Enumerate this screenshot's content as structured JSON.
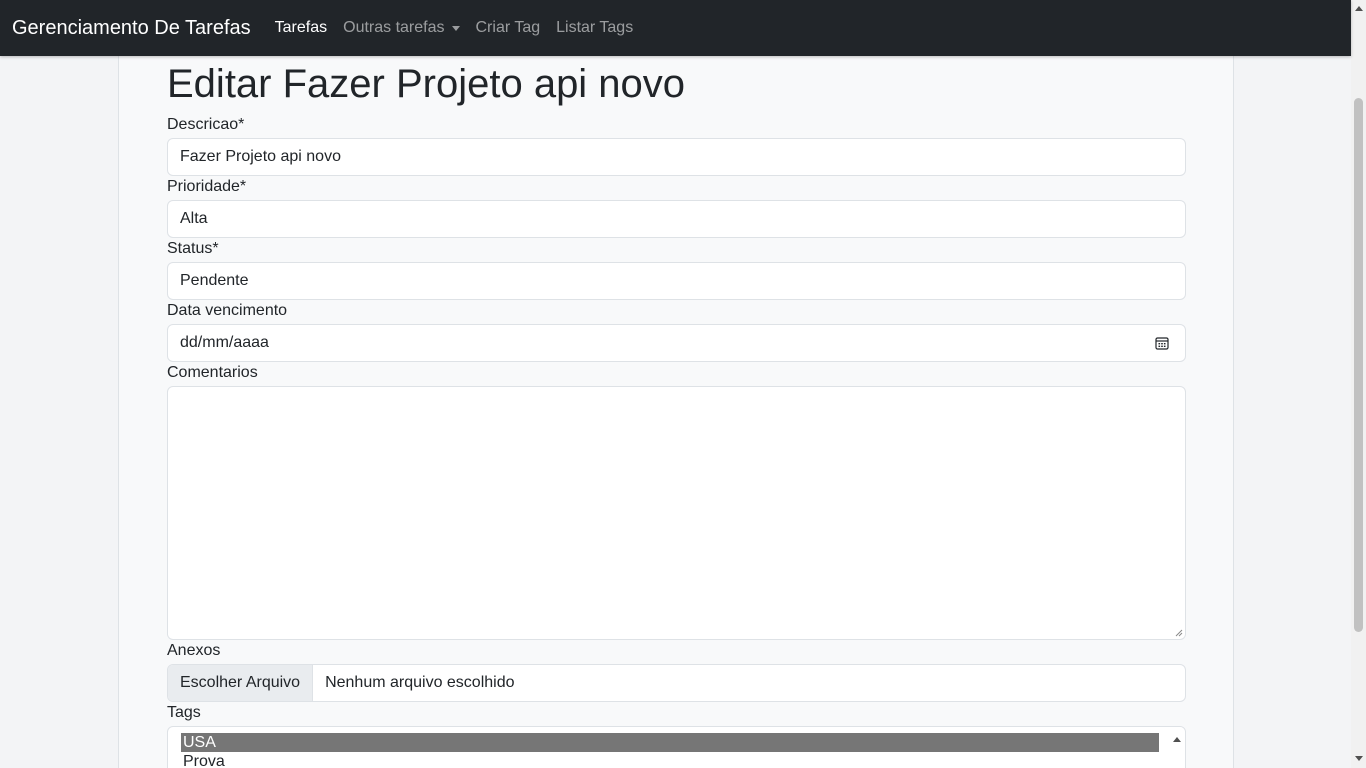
{
  "navbar": {
    "brand": "Gerenciamento De Tarefas",
    "links": [
      {
        "label": "Tarefas"
      },
      {
        "label": "Outras tarefas"
      },
      {
        "label": "Criar Tag"
      },
      {
        "label": "Listar Tags"
      }
    ]
  },
  "page": {
    "title": "Editar Fazer Projeto api novo"
  },
  "form": {
    "descricao": {
      "label": "Descricao*",
      "value": "Fazer Projeto api novo"
    },
    "prioridade": {
      "label": "Prioridade*",
      "value": "Alta"
    },
    "status": {
      "label": "Status*",
      "value": "Pendente"
    },
    "data_vencimento": {
      "label": "Data vencimento",
      "value": "dd/mm/aaaa"
    },
    "comentarios": {
      "label": "Comentarios",
      "value": ""
    },
    "anexos": {
      "label": "Anexos",
      "button_label": "Escolher Arquivo",
      "status": "Nenhum arquivo escolhido"
    },
    "tags": {
      "label": "Tags",
      "options": [
        {
          "label": "USA",
          "selected": true
        },
        {
          "label": "Prova",
          "selected": false
        }
      ]
    }
  }
}
